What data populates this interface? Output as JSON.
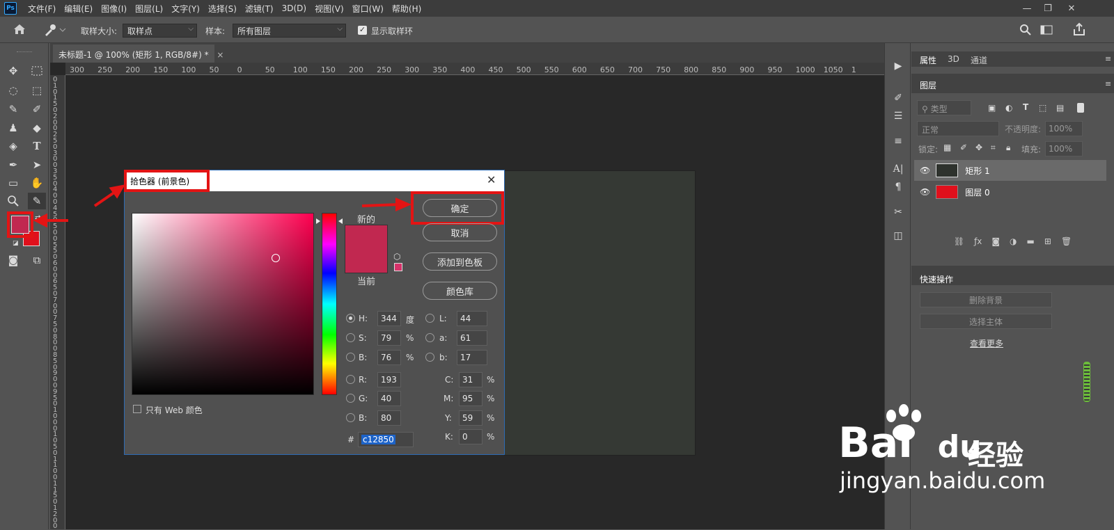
{
  "app": {
    "logo": "Ps"
  },
  "menu": [
    "文件(F)",
    "编辑(E)",
    "图像(I)",
    "图层(L)",
    "文字(Y)",
    "选择(S)",
    "滤镜(T)",
    "3D(D)",
    "视图(V)",
    "窗口(W)",
    "帮助(H)"
  ],
  "options": {
    "sample_size_label": "取样大小:",
    "sample_size_value": "取样点",
    "sample_label": "样本:",
    "sample_value": "所有图层",
    "show_ring_label": "显示取样环"
  },
  "document": {
    "tab_title": "未标题-1 @ 100% (矩形 1, RGB/8#) *",
    "close": "×"
  },
  "ruler": {
    "h": [
      "300",
      "250",
      "200",
      "150",
      "100",
      "50",
      "0",
      "50",
      "100",
      "150",
      "200",
      "250",
      "300",
      "350",
      "400",
      "450",
      "500",
      "550",
      "600",
      "650",
      "700",
      "750",
      "800",
      "850",
      "900",
      "950",
      "1000",
      "1050",
      "1"
    ],
    "v": [
      "0",
      "1",
      "0",
      "1",
      "5",
      "0",
      "2",
      "0",
      "0",
      "2",
      "5",
      "0",
      "3",
      "0",
      "0",
      "3",
      "5",
      "0",
      "4",
      "0",
      "0",
      "4",
      "5",
      "0",
      "5",
      "0",
      "0",
      "5",
      "5",
      "0",
      "6",
      "0",
      "0",
      "6",
      "5",
      "0",
      "7",
      "0",
      "0",
      "7",
      "5",
      "0",
      "8",
      "0",
      "0",
      "8",
      "5",
      "0",
      "9",
      "0",
      "0",
      "9",
      "5",
      "0",
      "1",
      "0",
      "0",
      "0",
      "1",
      "0",
      "5",
      "0",
      "1",
      "1",
      "0",
      "0",
      "1",
      "1",
      "5",
      "0",
      "1",
      "2",
      "0",
      "0"
    ]
  },
  "colors": {
    "foreground": "#c12850",
    "background": "#e0101c",
    "accent_red": "#e31414",
    "layer0_thumb": "#e0101c",
    "canvas": "#353934"
  },
  "panels": {
    "tabs": [
      "属性",
      "3D",
      "通道"
    ],
    "layers_title": "图层",
    "kind_label": "类型",
    "blend_mode": "正常",
    "opacity_label": "不透明度:",
    "opacity_value": "100%",
    "lock_label": "锁定:",
    "fill_label": "填充:",
    "fill_value": "100%",
    "layers": [
      {
        "name": "矩形 1"
      },
      {
        "name": "图层 0"
      }
    ],
    "quick_actions_title": "快速操作",
    "remove_bg": "删除背景",
    "select_subject": "选择主体",
    "see_more": "查看更多"
  },
  "dialog": {
    "title": "拾色器 (前景色)",
    "ok": "确定",
    "cancel": "取消",
    "add_swatch": "添加到色板",
    "color_libs": "颜色库",
    "new_label": "新的",
    "current_label": "当前",
    "web_only": "只有 Web 颜色",
    "fields": {
      "H": "344",
      "S": "79",
      "B": "76",
      "R": "193",
      "G": "40",
      "Bb": "80",
      "L": "44",
      "a": "61",
      "b": "17",
      "C": "31",
      "M": "95",
      "Y": "59",
      "K": "0",
      "hex": "c12850"
    },
    "units": {
      "deg": "度",
      "pct": "%"
    },
    "labels": {
      "H": "H:",
      "S": "S:",
      "B": "B:",
      "R": "R:",
      "G": "G:",
      "Bb": "B:",
      "L": "L:",
      "a": "a:",
      "b": "b:",
      "C": "C:",
      "M": "M:",
      "Y": "Y:",
      "K": "K:",
      "hash": "#"
    }
  },
  "watermark": {
    "brand": "Bai",
    "brand2": "du",
    "cn": "经验",
    "url": "jingyan.baidu.com"
  }
}
